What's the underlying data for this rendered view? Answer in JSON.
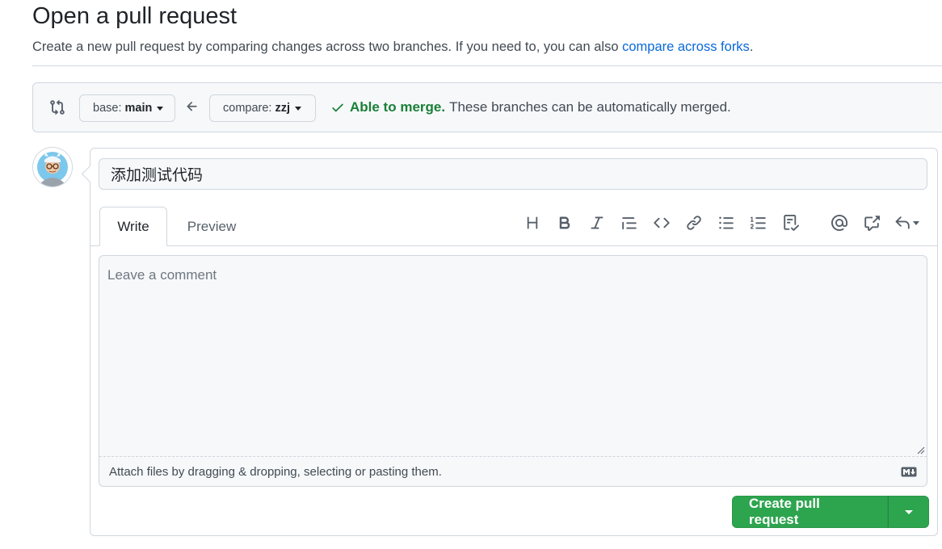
{
  "page": {
    "title": "Open a pull request",
    "subtitle_prefix": "Create a new pull request by comparing changes across two branches. If you need to, you can also ",
    "subtitle_link": "compare across forks",
    "subtitle_suffix": "."
  },
  "range": {
    "base_label": "base:",
    "base_branch": "main",
    "compare_label": "compare:",
    "compare_branch": "zzj",
    "merge_ok": "Able to merge.",
    "merge_text": "These branches can be automatically merged.",
    "status_color": "#1a7f37"
  },
  "form": {
    "title_value": "添加测试代码",
    "tabs": [
      {
        "label": "Write",
        "active": true
      },
      {
        "label": "Preview",
        "active": false
      }
    ],
    "toolbar_icons": [
      "heading-icon",
      "bold-icon",
      "italic-icon",
      "quote-icon",
      "code-icon",
      "link-icon",
      "unordered-list-icon",
      "ordered-list-icon",
      "task-list-icon",
      "mention-icon",
      "cross-reference-icon",
      "saved-replies-icon"
    ],
    "comment_placeholder": "Leave a comment",
    "attach_text": "Attach files by dragging & dropping, selecting or pasting them.",
    "submit_label": "Create pull request",
    "submit_color": "#2da44e"
  }
}
